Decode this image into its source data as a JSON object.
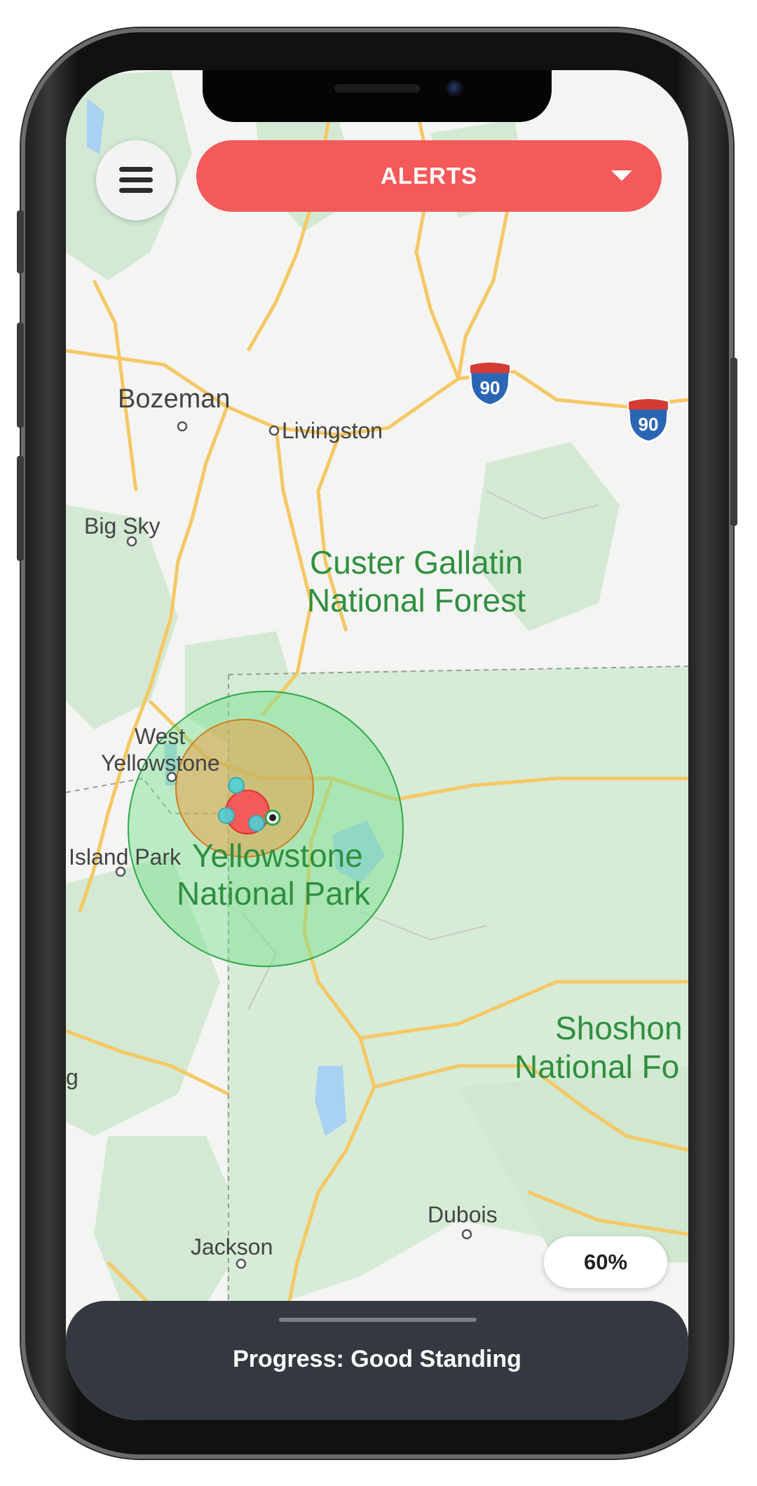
{
  "header": {
    "alerts_label": "ALERTS",
    "menu_icon": "hamburger-menu-icon",
    "dropdown_icon": "caret-down-icon"
  },
  "map": {
    "cities": {
      "bozeman": "Bozeman",
      "livingston": "Livingston",
      "big_sky": "Big Sky",
      "west_yellowstone_1": "West",
      "west_yellowstone_2": "Yellowstone",
      "island_park": "Island Park",
      "jackson": "Jackson",
      "dubois": "Dubois",
      "partial_left": "g"
    },
    "parks": {
      "custer_1": "Custer Gallatin",
      "custer_2": "National Forest",
      "yellowstone_1": "Yellowstone",
      "yellowstone_2": "National Park",
      "shoshone_1": "Shoshon",
      "shoshone_2": "National Fo"
    },
    "highway": "90",
    "colors": {
      "outer_radius": "#74e08b",
      "middle_radius": "#e8a14a",
      "inner_radius": "#f45a59",
      "marker": "#4fd0d6"
    }
  },
  "zoom": {
    "label": "60%"
  },
  "footer": {
    "progress_text": "Progress: Good Standing"
  },
  "theme": {
    "accent": "#f45a59",
    "sheet": "#343941"
  }
}
